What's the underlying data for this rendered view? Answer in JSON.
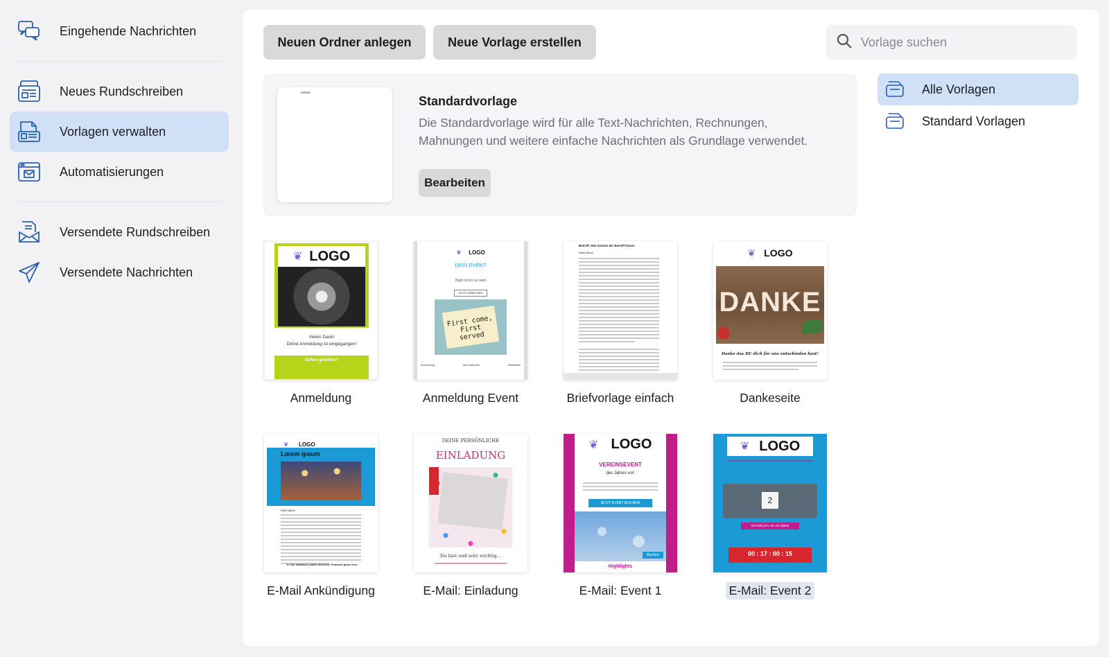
{
  "sidebar": {
    "items": [
      {
        "label": "Eingehende Nachrichten",
        "icon": "chat-bubbles-icon"
      },
      {
        "label": "Neues Rundschreiben",
        "icon": "newsletter-icon"
      },
      {
        "label": "Vorlagen verwalten",
        "icon": "template-icon",
        "active": true
      },
      {
        "label": "Automatisierungen",
        "icon": "automation-icon"
      },
      {
        "label": "Versendete Rundschreiben",
        "icon": "sent-newsletter-icon"
      },
      {
        "label": "Versendete Nachrichten",
        "icon": "paper-plane-icon"
      }
    ]
  },
  "toolbar": {
    "new_folder": "Neuen Ordner anlegen",
    "new_template": "Neue Vorlage erstellen",
    "search_placeholder": "Vorlage suchen"
  },
  "default_template": {
    "title": "Standardvorlage",
    "description": "Die Standardvorlage wird für alle Text-Nachrichten, Rechnungen, Mahnungen und weitere einfache Nachrichten als Grundlage verwendet.",
    "edit_label": "Bearbeiten"
  },
  "folders": [
    {
      "label": "Alle Vorlagen",
      "active": true
    },
    {
      "label": "Standard Vorlagen",
      "active": false
    }
  ],
  "templates": [
    {
      "label": "Anmeldung",
      "thumb": {
        "logo": "LOGO",
        "line1": "Vielen Dank!",
        "line2": "Deine Anmeldung ist eingegangen!",
        "footer": "Schon gesehen?"
      }
    },
    {
      "label": "Anmeldung Event",
      "thumb": {
        "logo": "LOGO",
        "heading": "DEIN EVENT",
        "sub": "Bald ist es so weit",
        "button": "JETZT ANMELDEN",
        "note": "First come, First served",
        "nav1": "Anmeldung",
        "nav2": "Informationen",
        "nav3": "Statistiken"
      }
    },
    {
      "label": "Briefvorlage einfach",
      "thumb": {
        "heading": "Betreff: Hier kommt der Betreff hinein",
        "greeting": "Hallo Name,"
      }
    },
    {
      "label": "Dankeseite",
      "thumb": {
        "logo": "LOGO",
        "word": "DANKE",
        "caption": "Danke das DU dich für uns entschieden hast!"
      }
    },
    {
      "label": "E-Mail Ankündigung",
      "thumb": {
        "logo": "LOGO",
        "heading": "Lorem ipsum",
        "greeting": "Hey name,",
        "footer": "In hac habitasse platea dictumst. Praesent justo eros,"
      }
    },
    {
      "label": "E-Mail: Einladung",
      "thumb": {
        "top": "DEINE PERSÖNLICHE",
        "heading": "EINLADUNG",
        "footer": "Du bist und sehr wichtig..."
      }
    },
    {
      "label": "E-Mail: Event 1",
      "thumb": {
        "logo": "LOGO",
        "heading": "VEREINSEVENT",
        "sub": "des Jahres vor!",
        "button": "JETZT EVENT BUCHEN!",
        "button2": "Buchen",
        "footer": "Highlights"
      }
    },
    {
      "label": "E-Mail: Event 2",
      "thumb": {
        "logo": "LOGO",
        "count": "2",
        "button": "NATÜRLICH, bin ich dabei!",
        "timer": "00 : 17 : 00 : 15",
        "selected": true
      }
    }
  ]
}
